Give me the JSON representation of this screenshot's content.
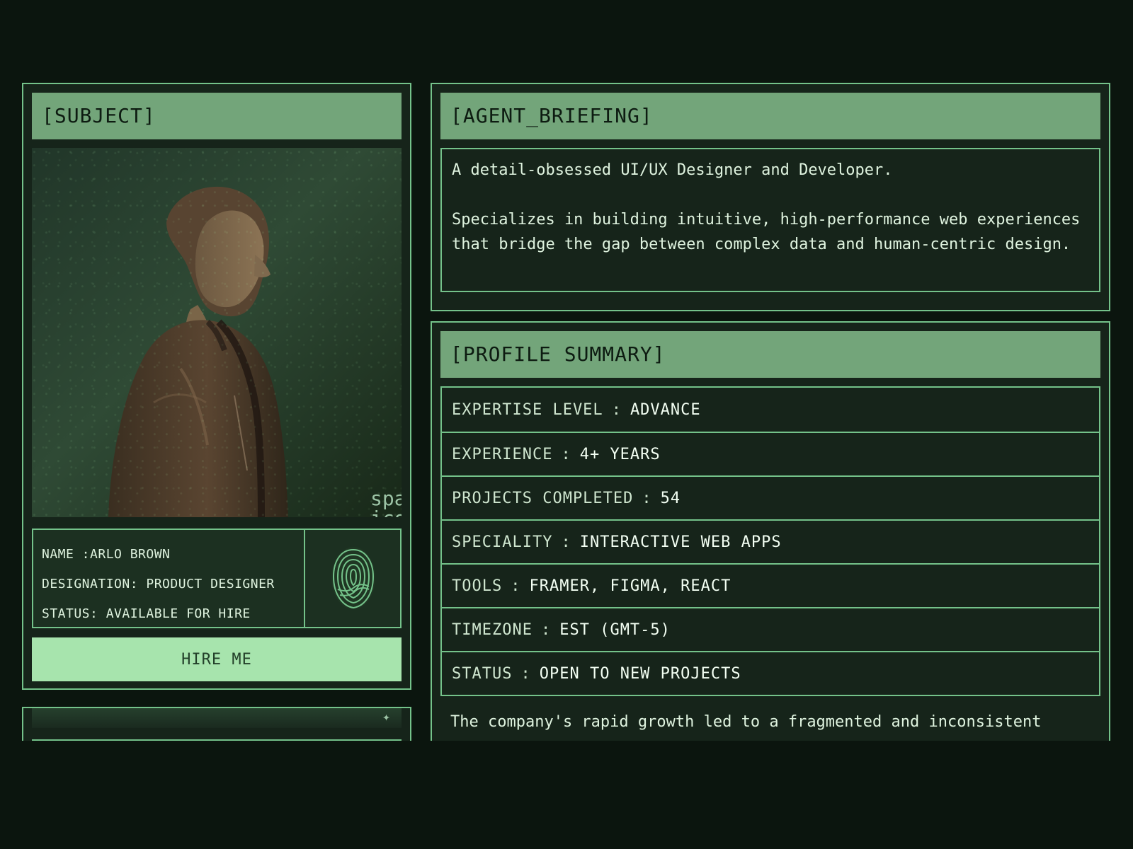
{
  "subject_card": {
    "header": "[SUBJECT]",
    "portrait_icon": "sparkle-icon",
    "info": {
      "name": "NAME :ARLO BROWN",
      "designation": "DESIGNATION: PRODUCT DESIGNER",
      "status": "STATUS: AVAILABLE FOR HIRE"
    },
    "fingerprint_icon": "fingerprint-icon",
    "hire_label": "HIRE ME"
  },
  "agent_briefing": {
    "header": "[AGENT_BRIEFING]",
    "text": "A detail-obsessed UI/UX Designer and Developer.\n\nSpecializes in building intuitive, high-performance web experiences that bridge the gap between complex data and human-centric design."
  },
  "profile_summary": {
    "header": "[PROFILE SUMMARY]",
    "rows": [
      {
        "label": "EXPERTISE LEVEL",
        "value": "ADVANCE"
      },
      {
        "label": "EXPERIENCE",
        "value": "4+ YEARS"
      },
      {
        "label": "PROJECTS COMPLETED",
        "value": "54"
      },
      {
        "label": "SPECIALITY",
        "value": "INTERACTIVE WEB APPS"
      },
      {
        "label": "TOOLS",
        "value": "FRAMER, FIGMA, REACT"
      },
      {
        "label": "TIMEZONE",
        "value": "EST (GMT-5)"
      },
      {
        "label": "STATUS",
        "value": "OPEN TO NEW PROJECTS"
      }
    ],
    "footer_text": "The company's rapid growth led to a fragmented and inconsistent"
  },
  "colors": {
    "background": "#0b150e",
    "panel": "#16241a",
    "border": "#74c28a",
    "header": "#73a57a",
    "button": "#a7e4ad"
  }
}
